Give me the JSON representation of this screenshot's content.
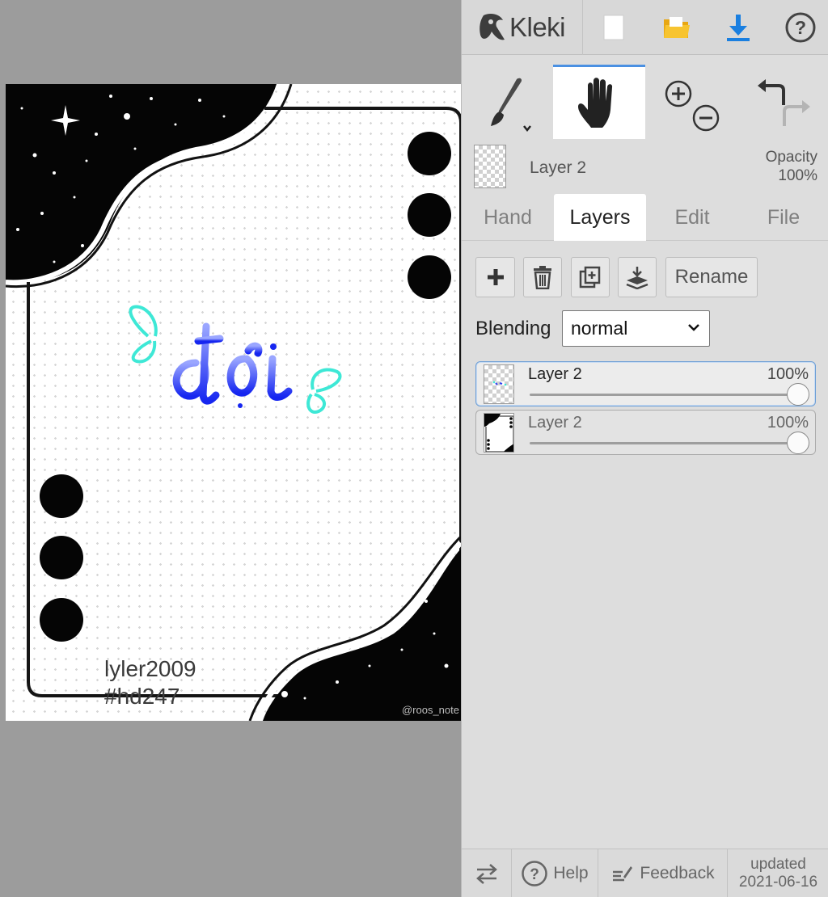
{
  "app": {
    "name": "Kleki"
  },
  "icons": {
    "logo": "kleki-logo-icon",
    "new": "new-file-icon",
    "open": "folder-icon",
    "save": "download-icon",
    "help": "help-icon",
    "brush": "brush-icon",
    "hand": "hand-icon",
    "zoom_in": "zoom-in-icon",
    "zoom_out": "zoom-out-icon",
    "undo": "undo-icon",
    "redo": "redo-icon",
    "add_layer": "plus-icon",
    "delete_layer": "trash-icon",
    "duplicate_layer": "duplicate-icon",
    "merge_layer": "merge-down-icon",
    "swap": "swap-icon",
    "feedback": "feedback-icon"
  },
  "colors": {
    "accent": "#4a90e2",
    "panel_bg": "#dddddd",
    "save_icon": "#1a7fe0",
    "folder_icon": "#f3b81c",
    "art_text": "#2d38f0",
    "art_wings": "#3ee8d6"
  },
  "current_layer": {
    "name": "Layer 2",
    "opacity_label": "Opacity",
    "opacity_value": "100%"
  },
  "tabs": {
    "hand": "Hand",
    "layers": "Layers",
    "edit": "Edit",
    "file": "File"
  },
  "layer_actions": {
    "rename": "Rename"
  },
  "blending": {
    "label": "Blending",
    "value": "normal"
  },
  "layers": [
    {
      "name": "Layer 2",
      "opacity": "100%",
      "opacity_value": 1.0,
      "selected": true
    },
    {
      "name": "Layer 2",
      "opacity": "100%",
      "opacity_value": 1.0,
      "selected": false
    }
  ],
  "bottom": {
    "help": "Help",
    "feedback": "Feedback",
    "updated_label": "updated",
    "updated_date": "2021-06-16"
  },
  "artwork": {
    "title_text": "đợi",
    "watermark_user": "lyler2009",
    "watermark_tag": "#hd247",
    "credit": "@roos_note"
  }
}
